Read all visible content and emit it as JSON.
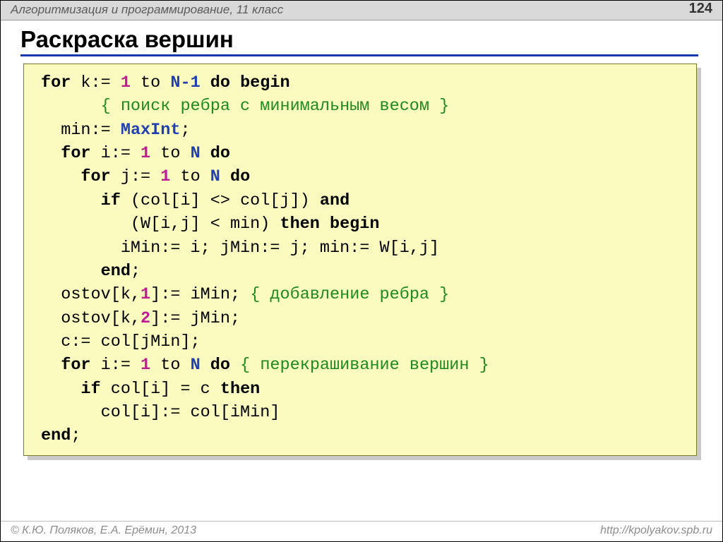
{
  "header": {
    "title": "Алгоритмизация и программирование, 11 класс",
    "page": "124"
  },
  "title": "Раскраска вершин",
  "code": {
    "l1": {
      "a": "for",
      "b": " k:= ",
      "c": "1",
      "d": " to ",
      "e": "N-1",
      "f": " do begin"
    },
    "l2": {
      "a": "{ поиск ребра с минимальным весом }"
    },
    "l3": {
      "a": "min:= ",
      "b": "MaxInt",
      "c": ";"
    },
    "l4": {
      "a": "for",
      "b": " i:= ",
      "c": "1",
      "d": " to ",
      "e": "N",
      "f": " do"
    },
    "l5": {
      "a": "for",
      "b": " j:= ",
      "c": "1",
      "d": " to ",
      "e": "N",
      "f": " do"
    },
    "l6": {
      "a": "if",
      "b": " (col[i] <> col[j]) ",
      "c": "and"
    },
    "l7": {
      "a": "(W[i,j] < min) ",
      "b": "then begin"
    },
    "l8": {
      "a": "iMin:= i; jMin:= j; min:= W[i,j]"
    },
    "l9": {
      "a": "end",
      "b": ";"
    },
    "l10": {
      "a": "ostov[k,",
      "b": "1",
      "c": "]:= iMin; ",
      "d": "{ добавление ребра }"
    },
    "l11": {
      "a": "ostov[k,",
      "b": "2",
      "c": "]:= jMin;"
    },
    "l12": {
      "a": "c:= col[jMin];"
    },
    "l13": {
      "a": "for",
      "b": " i:= ",
      "c": "1",
      "d": " to ",
      "e": "N",
      "f": " do ",
      "g": "{ перекрашивание вершин }"
    },
    "l14": {
      "a": "if",
      "b": " col[i] = c ",
      "c": "then"
    },
    "l15": {
      "a": "col[i]:= col[iMin]"
    },
    "l16": {
      "a": "end",
      "b": ";"
    }
  },
  "footer": {
    "left": "© К.Ю. Поляков, Е.А. Ерёмин, 2013",
    "right": "http://kpolyakov.spb.ru"
  }
}
